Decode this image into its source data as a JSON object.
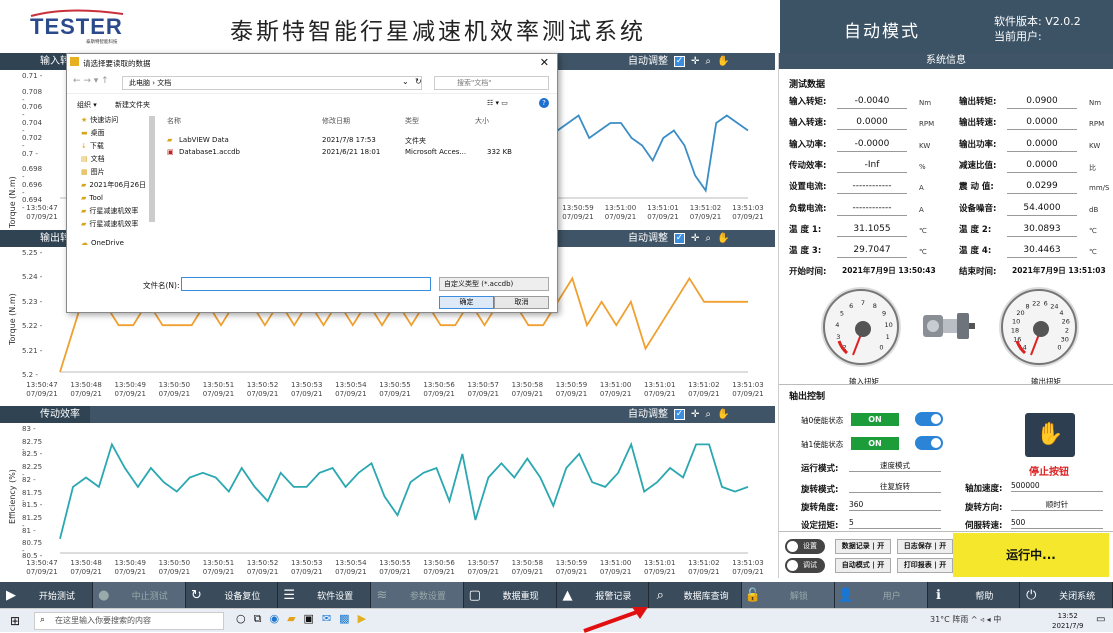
{
  "header": {
    "app_title": "泰斯特智能行星减速机效率测试系统",
    "logo_text": "TESTER",
    "logo_sub": "泰斯特智能科技",
    "mode": "自动模式",
    "version_label": "软件版本: V2.0.2",
    "user_label": "当前用户:",
    "brand_color": "#3c5366"
  },
  "panels": {
    "input_torque": {
      "title": "输入转矩",
      "ylabel": "Torque (N.m)",
      "auto_adjust": "自动调整",
      "yticks": [
        "0.71 -",
        "0.708 -",
        "0.706 -",
        "0.704 -",
        "0.702 -",
        "0.7 -",
        "0.698 -",
        "0.696 -",
        "0.694 -"
      ],
      "x_first": "13:50:47",
      "x_first_date": "07/09/21",
      "x_ticks": [
        "13:50:59",
        "13:51:00",
        "13:51:01",
        "13:51:02",
        "13:51:03"
      ],
      "x_date": "07/09/21",
      "color": "#3b8dc6"
    },
    "output_torque": {
      "title": "输出转矩",
      "ylabel": "Torque (N.m)",
      "auto_adjust": "自动调整",
      "yticks": [
        "5.25 -",
        "5.24 -",
        "5.23 -",
        "5.22 -",
        "5.21 -",
        "5.2 -"
      ],
      "x_ticks": [
        "13:50:47",
        "13:50:48",
        "13:50:49",
        "13:50:50",
        "13:50:51",
        "13:50:52",
        "13:50:53",
        "13:50:54",
        "13:50:55",
        "13:50:56",
        "13:50:57",
        "13:50:58",
        "13:50:59",
        "13:51:00",
        "13:51:01",
        "13:51:02",
        "13:51:03"
      ],
      "x_date": "07/09/21",
      "color": "#f0a030"
    },
    "efficiency": {
      "title": "传动效率",
      "ylabel": "Efficiency (%)",
      "auto_adjust": "自动调整",
      "yticks": [
        "83 -",
        "82.75 -",
        "82.5 -",
        "82.25 -",
        "82 -",
        "81.75 -",
        "81.5 -",
        "81.25 -",
        "81 -",
        "80.75 -",
        "80.5 -"
      ],
      "x_ticks": [
        "13:50:47",
        "13:50:48",
        "13:50:49",
        "13:50:50",
        "13:50:51",
        "13:50:52",
        "13:50:53",
        "13:50:54",
        "13:50:55",
        "13:50:56",
        "13:50:57",
        "13:50:58",
        "13:50:59",
        "13:51:00",
        "13:51:01",
        "13:51:02",
        "13:51:03"
      ],
      "x_date": "07/09/21",
      "color": "#2aa7b0"
    }
  },
  "chart_data": [
    {
      "type": "line",
      "title": "输入转矩",
      "ylabel": "Torque (N.m)",
      "ylim": [
        0.694,
        0.71
      ],
      "series": [
        {
          "values": [
            0.703,
            0.702,
            0.704,
            0.705,
            0.704,
            0.706,
            0.705,
            0.706,
            0.703,
            0.704,
            0.705,
            0.702,
            0.703,
            0.704,
            0.704,
            0.702,
            0.701,
            0.699,
            0.702,
            0.703,
            0.701,
            0.697,
            0.695,
            0.704,
            0.705,
            0.704,
            0.703
          ]
        }
      ],
      "x_visible": [
        "13:50:59",
        "13:51:00",
        "13:51:01",
        "13:51:02",
        "13:51:03"
      ]
    },
    {
      "type": "line",
      "title": "输出转矩",
      "ylabel": "Torque (N.m)",
      "ylim": [
        5.2,
        5.25
      ],
      "series": [
        {
          "values": [
            5.2,
            5.22,
            5.24,
            5.23,
            5.22,
            5.22,
            5.23,
            5.22,
            5.22,
            5.22,
            5.23,
            5.22,
            5.23,
            5.23,
            5.22,
            5.23,
            5.22,
            5.23,
            5.22,
            5.23,
            5.22,
            5.23,
            5.22,
            5.23,
            5.22,
            5.23,
            5.22,
            5.22,
            5.23,
            5.22,
            5.23,
            5.23,
            5.22,
            5.22,
            5.23,
            5.24,
            5.22,
            5.23,
            5.22,
            5.23,
            5.21,
            5.22,
            5.23,
            5.24,
            5.23,
            5.23,
            5.23,
            5.23
          ]
        }
      ]
    },
    {
      "type": "line",
      "title": "传动效率",
      "ylabel": "Efficiency (%)",
      "ylim": [
        80.5,
        83
      ],
      "series": [
        {
          "values": [
            80.8,
            81.9,
            82.1,
            81.9,
            82.8,
            82.3,
            81.9,
            82.3,
            82.0,
            81.8,
            82.1,
            82.2,
            82.1,
            81.8,
            82.3,
            81.9,
            81.6,
            82.2,
            81.9,
            81.9,
            82.2,
            82.3,
            81.9,
            82.2,
            82.4,
            81.7,
            81.3,
            82.0,
            82.2,
            82.3,
            81.6,
            82.6,
            81.2,
            82.1,
            82.4,
            82.1,
            82.5,
            82.1,
            81.5,
            82.3,
            82.6,
            82.0,
            81.9,
            82.2,
            82.8,
            81.8,
            82.0,
            82.3,
            82.1,
            82.8,
            82.8,
            81.9,
            81.8,
            81.9
          ]
        }
      ]
    }
  ],
  "dialog": {
    "title": "请选择要读取的数据",
    "path": "此电脑 › 文档",
    "search": "搜索\"文档\"",
    "org": "组织 ▾",
    "newfolder": "新建文件夹",
    "col_name": "名称",
    "col_date": "修改日期",
    "col_type": "类型",
    "col_size": "大小",
    "tree": [
      "快速访问",
      "桌面",
      "下载",
      "文档",
      "图片",
      "2021年06月26日",
      "Tool",
      "行星减速机效率",
      "行星减速机效率",
      "OneDrive"
    ],
    "files": [
      {
        "name": "LabVIEW Data",
        "date": "2021/7/8 17:53",
        "type": "文件夹",
        "size": ""
      },
      {
        "name": "Database1.accdb",
        "date": "2021/6/21 18:01",
        "type": "Microsoft Acces...",
        "size": "332 KB"
      }
    ],
    "fn_label": "文件名(N):",
    "ftype": "自定义类型 (*.accdb)",
    "ok": "确定",
    "cancel": "取消"
  },
  "sysinfo": {
    "title": "系统信息",
    "data_title": "测试数据",
    "rows": [
      {
        "l1": "输入转矩:",
        "v1": "-0.0040",
        "u1": "Nm",
        "l2": "输出转矩:",
        "v2": "0.0900",
        "u2": "Nm"
      },
      {
        "l1": "输入转速:",
        "v1": "0.0000",
        "u1": "RPM",
        "l2": "输出转速:",
        "v2": "0.0000",
        "u2": "RPM"
      },
      {
        "l1": "输入功率:",
        "v1": "-0.0000",
        "u1": "KW",
        "l2": "输出功率:",
        "v2": "0.0000",
        "u2": "KW"
      },
      {
        "l1": "传动效率:",
        "v1": "-Inf",
        "u1": "%",
        "l2": "减速比值:",
        "v2": "0.0000",
        "u2": "比"
      },
      {
        "l1": "设置电流:",
        "v1": "------------",
        "u1": "A",
        "l2": "震 动 值:",
        "v2": "0.0299",
        "u2": "mm/S"
      },
      {
        "l1": "负载电流:",
        "v1": "------------",
        "u1": "A",
        "l2": "设备噪音:",
        "v2": "54.4000",
        "u2": "dB"
      },
      {
        "l1": "温 度 1:",
        "v1": "31.1055",
        "u1": "℃",
        "l2": "温 度 2:",
        "v2": "30.0893",
        "u2": "℃"
      },
      {
        "l1": "温 度 3:",
        "v1": "29.7047",
        "u1": "℃",
        "l2": "温 度 4:",
        "v2": "30.4463",
        "u2": "℃"
      }
    ],
    "start_label": "开始时间:",
    "start_val": "2021年7月9日 13:50:43",
    "end_label": "结束时间:",
    "end_val": "2021年7月9日 13:51:03",
    "gauge_in": "输入扭矩",
    "gauge_out": "输出扭矩",
    "gauge_in_ticks": [
      "2",
      "3",
      "4",
      "5",
      "6",
      "7",
      "8",
      "9",
      "10",
      "1",
      "0"
    ],
    "gauge_out_ticks": [
      "14",
      "16",
      "18",
      "10",
      "20",
      "8",
      "22",
      "6",
      "24",
      "4",
      "26",
      "2",
      "30",
      "0"
    ],
    "ctrl_title": "轴出控制",
    "axis0": "轴0使能状态",
    "axis1": "轴1使能状态",
    "on": "ON",
    "run_mode_l": "运行模式:",
    "run_mode_v": "速度模式",
    "rot_mode_l": "旋转模式:",
    "rot_mode_v": "往复旋转",
    "rot_angle_l": "旋转角度:",
    "rot_angle_v": "360",
    "set_torque_l": "设定扭矩:",
    "set_torque_v": "5",
    "accel_l": "轴加速度:",
    "accel_v": "500000",
    "dir_l": "旋转方向:",
    "dir_v": "顺时针",
    "servo_l": "伺服转速:",
    "servo_v": "500",
    "stop": "停止按钮",
    "setting": "设置",
    "debug": "调试",
    "b1": "数据记录 | 开",
    "b2": "日志保存 | 开",
    "b3": "自动模式 | 开",
    "b4": "打印报表 | 开",
    "running": "运行中..."
  },
  "buttons": [
    {
      "icon": "▶",
      "label": "开始测试",
      "dim": false
    },
    {
      "icon": "●",
      "label": "中止测试",
      "dim": true
    },
    {
      "icon": "↻",
      "label": "设备复位",
      "dim": false
    },
    {
      "icon": "☰",
      "label": "软件设置",
      "dim": false
    },
    {
      "icon": "≋",
      "label": "参数设置",
      "dim": true
    },
    {
      "icon": "▢",
      "label": "数据重现",
      "dim": false
    },
    {
      "icon": "▲",
      "label": "报警记录",
      "dim": false
    },
    {
      "icon": "⌕",
      "label": "数据库查询",
      "dim": false
    },
    {
      "icon": "🔓",
      "label": "解锁",
      "dim": true
    },
    {
      "icon": "👤",
      "label": "用户",
      "dim": true
    },
    {
      "icon": "ℹ",
      "label": "帮助",
      "dim": false
    },
    {
      "icon": "⏻",
      "label": "关闭系统",
      "dim": false
    }
  ],
  "taskbar": {
    "search": "在这里输入你要搜索的内容",
    "weather": "31°C 阵雨",
    "ime": "中",
    "time": "13:52",
    "date": "2021/7/9"
  }
}
